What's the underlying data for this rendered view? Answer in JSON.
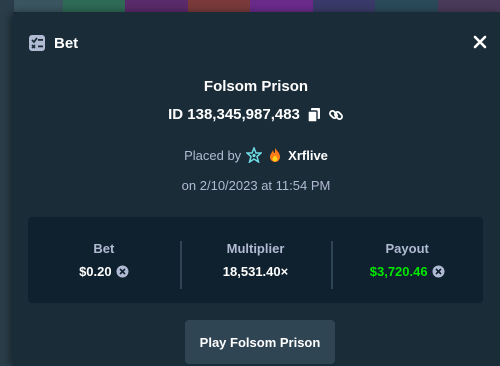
{
  "modal": {
    "title": "Bet",
    "icon": "bet-slip-icon"
  },
  "game": {
    "title": "Folsom Prison"
  },
  "bet": {
    "id": "ID 138,345,987,483"
  },
  "placed": {
    "prefix": "Placed by",
    "user": "Xrflive",
    "date": "on 2/10/2023 at 11:54 PM"
  },
  "stats": {
    "bet_label": "Bet",
    "bet_value": "$0.20",
    "multiplier_label": "Multiplier",
    "multiplier_value": "18,531.40×",
    "payout_label": "Payout",
    "payout_value": "$3,720.46"
  },
  "actions": {
    "play_label": "Play Folsom Prison"
  },
  "colors": {
    "background": "#1a2c38",
    "panel": "#0f212e",
    "button": "#2f4553",
    "payout": "#00e701",
    "muted_text": "#b1bad3"
  }
}
